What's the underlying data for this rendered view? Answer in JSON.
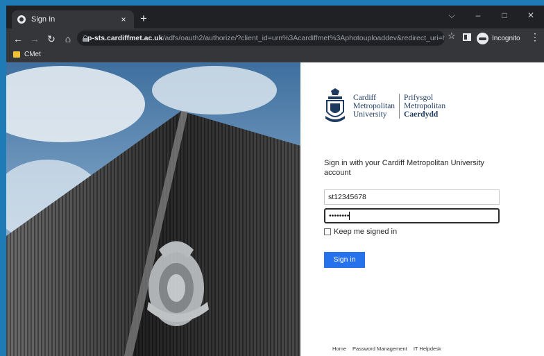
{
  "browser": {
    "tab_title": "Sign In",
    "new_tab": "+",
    "tab_close": "×",
    "window_controls": {
      "dropdown": "⌵",
      "minimize": "–",
      "maximize": "□",
      "close": "✕"
    },
    "url_host": "p-sts.cardiffmet.ac.uk",
    "url_path": "/adfs/oauth2/authorize/?client_id=urn%3Acardiffmet%3Aphotouploaddev&redirect_uri=http...",
    "incognito_label": "Incognito",
    "bookmarks": [
      "CMet"
    ]
  },
  "login": {
    "logo_en": [
      "Cardiff",
      "Metropolitan",
      "University"
    ],
    "logo_cy": [
      "Prifysgol",
      "Metropolitan",
      "Caerdydd"
    ],
    "intro_text": "Sign in with your Cardiff Metropolitan University account",
    "username_value": "st12345678",
    "password_masked": "••••••••",
    "keep_signed_in_label": "Keep me signed in",
    "keep_signed_in_checked": false,
    "sign_in_button": "Sign in",
    "footer_links": [
      "Home",
      "Password Management",
      "IT Helpdesk"
    ]
  },
  "colors": {
    "accent": "#2672ec",
    "desktop_background": "#1f7bb5",
    "browser_frame": "#202124"
  }
}
